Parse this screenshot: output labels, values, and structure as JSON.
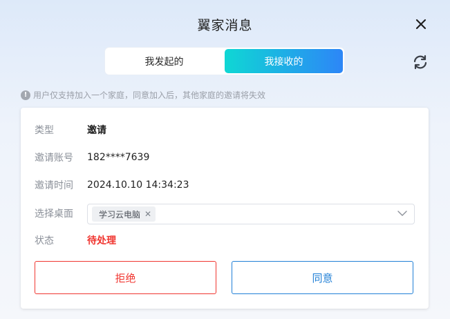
{
  "dialog": {
    "title": "翼家消息"
  },
  "tabs": [
    {
      "label": "我发起的",
      "active": false
    },
    {
      "label": "我接收的",
      "active": true
    }
  ],
  "notice": {
    "icon": "exclamation-circle-icon",
    "text": "用户仅支持加入一个家庭，同意加入后，其他家庭的邀请将失效"
  },
  "detail": {
    "type_label": "类型",
    "type_value": "邀请",
    "account_label": "邀请账号",
    "account_value": "182****7639",
    "time_label": "邀请时间",
    "time_value": "2024.10.10 14:34:23",
    "desktop_label": "选择桌面",
    "desktop_tag": "学习云电脑",
    "status_label": "状态",
    "status_value": "待处理"
  },
  "actions": {
    "reject_label": "拒绝",
    "accept_label": "同意"
  },
  "colors": {
    "accent_gradient_start": "#0fd7d4",
    "accent_gradient_end": "#2d86f7",
    "reject": "#f0352f",
    "accept": "#1f7fd6",
    "status": "#f0352f"
  }
}
